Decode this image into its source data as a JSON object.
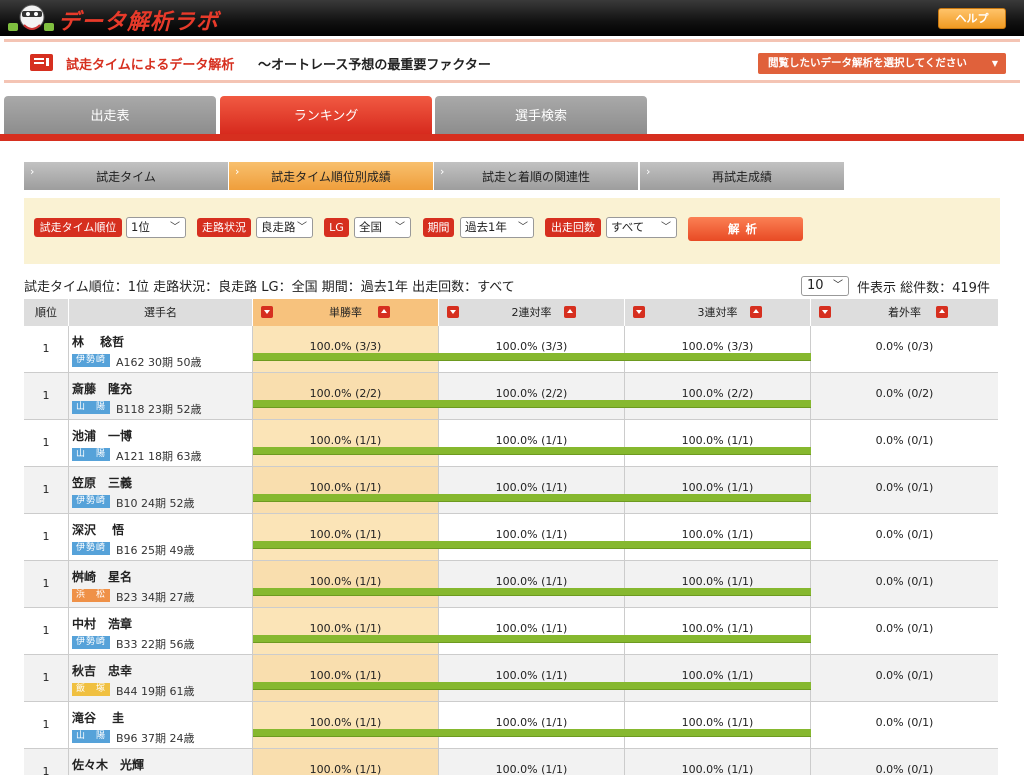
{
  "app": {
    "logo_text": "データ解析ラボ",
    "help_label": "ヘルプ"
  },
  "title": {
    "red": "試走タイムによるデータ解析",
    "black": "〜オートレース予想の最重要ファクター",
    "select_label": "閲覧したいデータ解析を選択してください"
  },
  "main_tabs": [
    "出走表",
    "ランキング",
    "選手検索"
  ],
  "sub_tabs": [
    "試走タイム",
    "試走タイム順位別成績",
    "試走と着順の関連性",
    "再試走成績"
  ],
  "filters": {
    "rank_label": "試走タイム順位",
    "rank_value": "1位",
    "road_label": "走路状況",
    "road_value": "良走路",
    "lg_label": "LG",
    "lg_value": "全国",
    "period_label": "期間",
    "period_value": "過去1年",
    "count_label": "出走回数",
    "count_value": "すべて",
    "analyze_label": "解析"
  },
  "summary": "試走タイム順位：1位 走路状況：良走路 LG：全国 期間：過去1年 出走回数：すべて",
  "pager": {
    "per_page": "10",
    "count_text": "件表示 総件数：419件"
  },
  "table": {
    "headers": [
      "順位",
      "選手名",
      "単勝率",
      "2連対率",
      "3連対率",
      "着外率"
    ],
    "rows": [
      {
        "rank": "1",
        "name": "林　 稔哲",
        "lg": "伊勢崎",
        "meta": "A162 30期 50歳",
        "win": "100.0% (3/3)",
        "top2": "100.0% (3/3)",
        "top3": "100.0% (3/3)",
        "out": "0.0% (0/3)"
      },
      {
        "rank": "1",
        "name": "斎藤　隆充",
        "lg": "山　陽",
        "meta": "B118 23期 52歳",
        "win": "100.0% (2/2)",
        "top2": "100.0% (2/2)",
        "top3": "100.0% (2/2)",
        "out": "0.0% (0/2)"
      },
      {
        "rank": "1",
        "name": "池浦　一博",
        "lg": "山　陽",
        "meta": "A121 18期 63歳",
        "win": "100.0% (1/1)",
        "top2": "100.0% (1/1)",
        "top3": "100.0% (1/1)",
        "out": "0.0% (0/1)"
      },
      {
        "rank": "1",
        "name": "笠原　三義",
        "lg": "伊勢崎",
        "meta": "B10 24期 52歳",
        "win": "100.0% (1/1)",
        "top2": "100.0% (1/1)",
        "top3": "100.0% (1/1)",
        "out": "0.0% (0/1)"
      },
      {
        "rank": "1",
        "name": "深沢　 悟",
        "lg": "伊勢崎",
        "meta": "B16 25期 49歳",
        "win": "100.0% (1/1)",
        "top2": "100.0% (1/1)",
        "top3": "100.0% (1/1)",
        "out": "0.0% (0/1)"
      },
      {
        "rank": "1",
        "name": "桝崎　星名",
        "lg": "浜　松",
        "meta": "B23 34期 27歳",
        "win": "100.0% (1/1)",
        "top2": "100.0% (1/1)",
        "top3": "100.0% (1/1)",
        "out": "0.0% (0/1)"
      },
      {
        "rank": "1",
        "name": "中村　浩章",
        "lg": "伊勢崎",
        "meta": "B33 22期 56歳",
        "win": "100.0% (1/1)",
        "top2": "100.0% (1/1)",
        "top3": "100.0% (1/1)",
        "out": "0.0% (0/1)"
      },
      {
        "rank": "1",
        "name": "秋吉　忠幸",
        "lg": "飯　塚",
        "meta": "B44 19期 61歳",
        "win": "100.0% (1/1)",
        "top2": "100.0% (1/1)",
        "top3": "100.0% (1/1)",
        "out": "0.0% (0/1)"
      },
      {
        "rank": "1",
        "name": "滝谷　 圭",
        "lg": "山　陽",
        "meta": "B96 37期 24歳",
        "win": "100.0% (1/1)",
        "top2": "100.0% (1/1)",
        "top3": "100.0% (1/1)",
        "out": "0.0% (0/1)"
      },
      {
        "rank": "1",
        "name": "佐々木　光輝",
        "lg": "",
        "meta": "",
        "win": "100.0% (1/1)",
        "top2": "100.0% (1/1)",
        "top3": "100.0% (1/1)",
        "out": "0.0% (0/1)"
      }
    ]
  }
}
